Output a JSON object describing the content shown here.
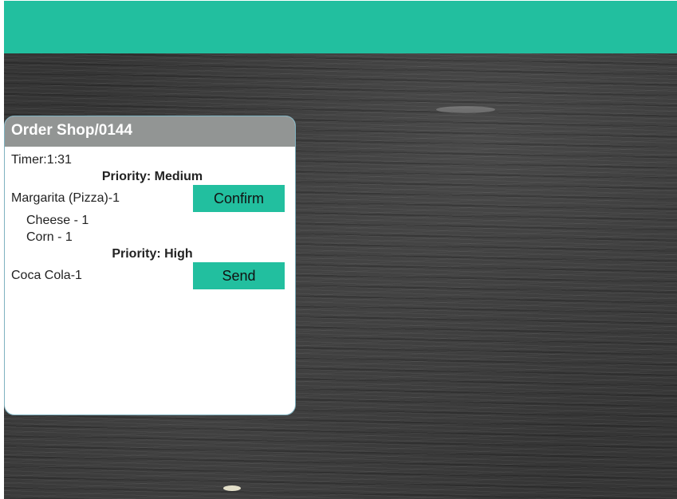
{
  "header": {
    "color": "#22bf9f"
  },
  "order": {
    "title": "Order Shop/0144",
    "timer": "Timer:1:31",
    "groups": [
      {
        "priority": "Priority: Medium",
        "item": "Margarita (Pizza)-1",
        "action_label": "Confirm",
        "toppings": [
          "Cheese - 1",
          "Corn - 1"
        ]
      },
      {
        "priority": "Priority: High",
        "item": "Coca Cola-1",
        "action_label": "Send",
        "toppings": []
      }
    ]
  },
  "colors": {
    "accent": "#22bf9f",
    "card_header": "#929594",
    "board": "#353535"
  }
}
